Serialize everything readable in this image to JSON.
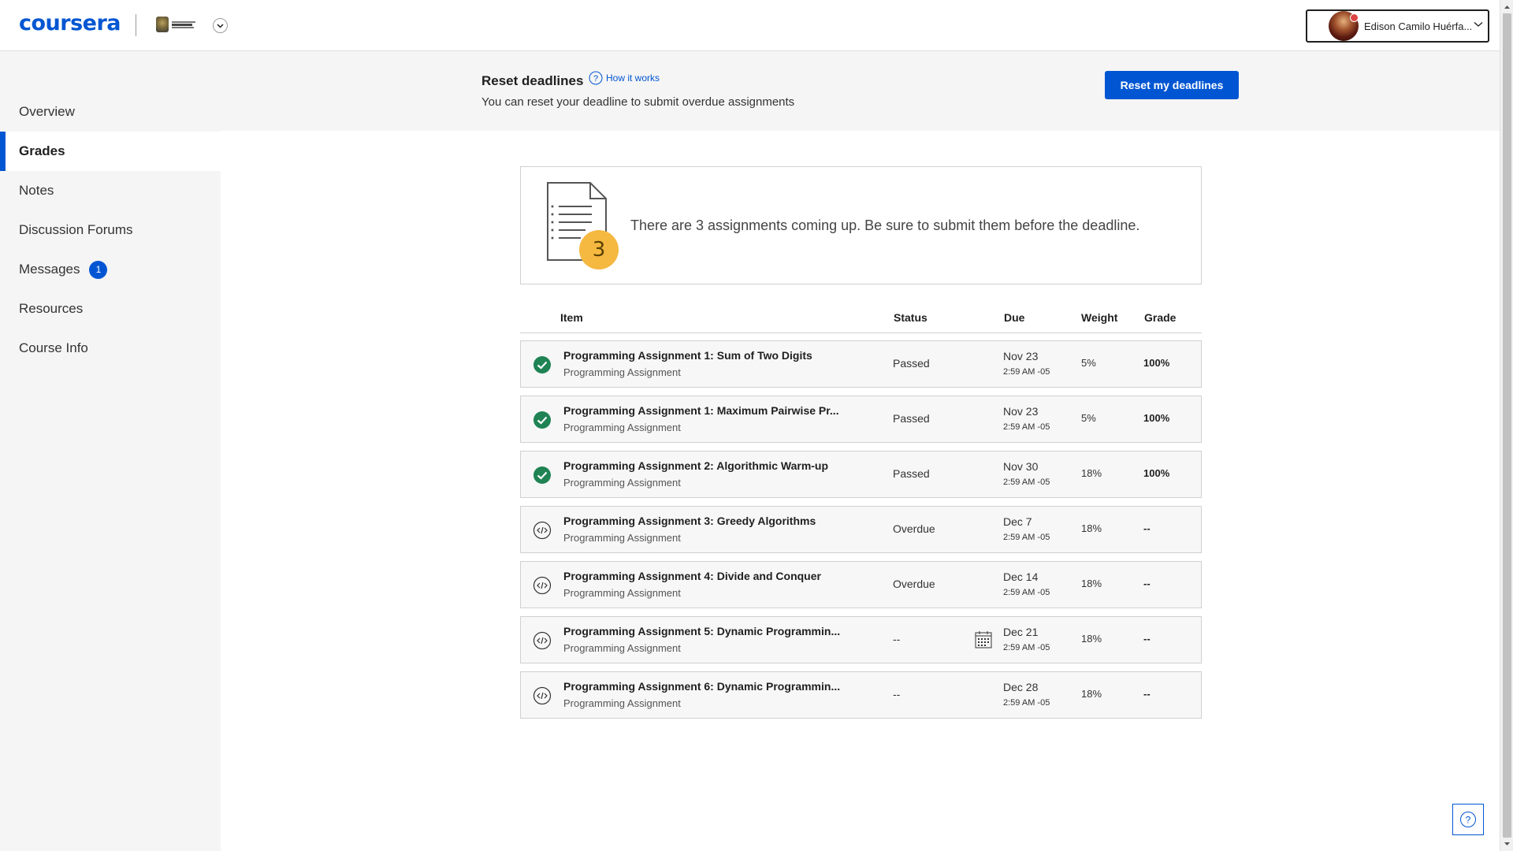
{
  "header": {
    "logo": "coursera",
    "user_name": "Edison Camilo Huérfa..."
  },
  "sidebar": {
    "items": [
      {
        "label": "Overview",
        "active": false
      },
      {
        "label": "Grades",
        "active": true
      },
      {
        "label": "Notes",
        "active": false
      },
      {
        "label": "Discussion Forums",
        "active": false
      },
      {
        "label": "Messages",
        "active": false,
        "badge": "1"
      },
      {
        "label": "Resources",
        "active": false
      },
      {
        "label": "Course Info",
        "active": false
      }
    ]
  },
  "banner": {
    "title": "Reset deadlines",
    "how_link": "How it works",
    "description": "You can reset your deadline to submit overdue assignments",
    "button_label": "Reset my deadlines"
  },
  "upcoming": {
    "count": "3",
    "message": "There are 3 assignments coming up. Be sure to submit them before the deadline."
  },
  "table": {
    "headers": {
      "item": "Item",
      "status": "Status",
      "due": "Due",
      "weight": "Weight",
      "grade": "Grade"
    },
    "rows": [
      {
        "title": "Programming Assignment 1: Sum of Two Digits",
        "type": "Programming Assignment",
        "status": "Passed",
        "due_date": "Nov 23",
        "due_time": "2:59 AM -05",
        "weight": "5%",
        "grade": "100%",
        "icon": "check-circle-icon"
      },
      {
        "title": "Programming Assignment 1: Maximum Pairwise Pr...",
        "type": "Programming Assignment",
        "status": "Passed",
        "due_date": "Nov 23",
        "due_time": "2:59 AM -05",
        "weight": "5%",
        "grade": "100%",
        "icon": "check-circle-icon"
      },
      {
        "title": "Programming Assignment 2: Algorithmic Warm-up",
        "type": "Programming Assignment",
        "status": "Passed",
        "due_date": "Nov 30",
        "due_time": "2:59 AM -05",
        "weight": "18%",
        "grade": "100%",
        "icon": "check-circle-icon"
      },
      {
        "title": "Programming Assignment 3: Greedy Algorithms",
        "type": "Programming Assignment",
        "status": "Overdue",
        "due_date": "Dec 7",
        "due_time": "2:59 AM -05",
        "weight": "18%",
        "grade": "--",
        "icon": "code-circle-icon"
      },
      {
        "title": "Programming Assignment 4: Divide and Conquer",
        "type": "Programming Assignment",
        "status": "Overdue",
        "due_date": "Dec 14",
        "due_time": "2:59 AM -05",
        "weight": "18%",
        "grade": "--",
        "icon": "code-circle-icon"
      },
      {
        "title": "Programming Assignment 5: Dynamic Programmin...",
        "type": "Programming Assignment",
        "status": "--",
        "due_date": "Dec 21",
        "due_time": "2:59 AM -05",
        "weight": "18%",
        "grade": "--",
        "icon": "code-circle-icon",
        "calendar": true
      },
      {
        "title": "Programming Assignment 6: Dynamic Programmin...",
        "type": "Programming Assignment",
        "status": "--",
        "due_date": "Dec 28",
        "due_time": "2:59 AM -05",
        "weight": "18%",
        "grade": "--",
        "icon": "code-circle-icon"
      }
    ]
  },
  "colors": {
    "brand": "#0056d2",
    "passed": "#1f8354",
    "upcoming_badge": "#f5b841"
  }
}
